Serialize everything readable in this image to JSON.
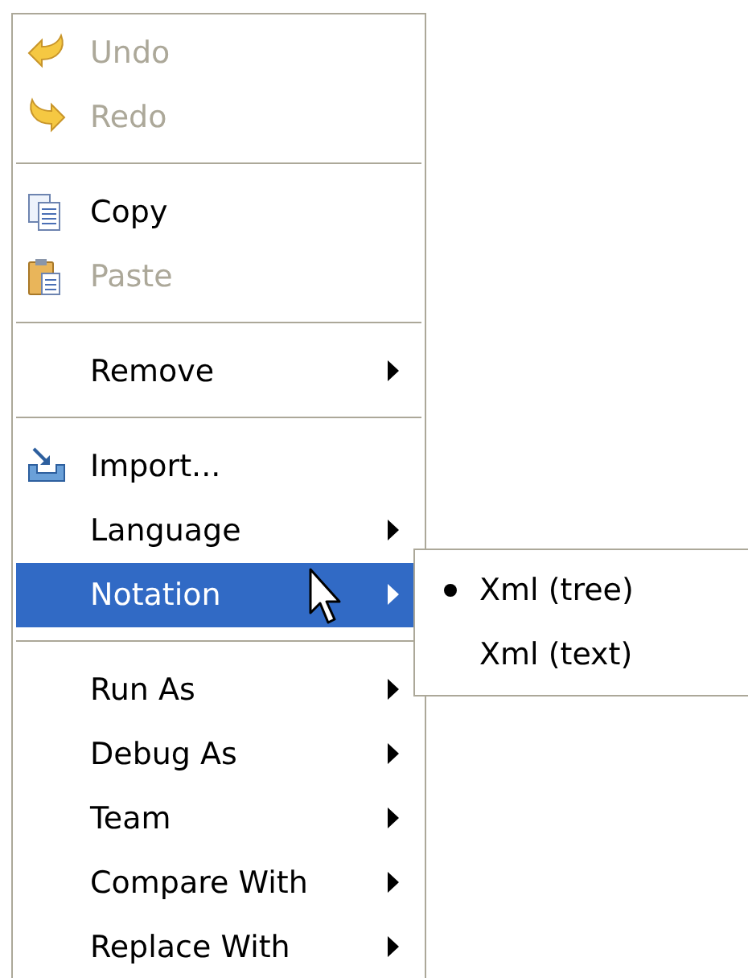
{
  "menu": {
    "items": [
      {
        "kind": "item",
        "label": "Undo",
        "disabled": true,
        "submenu": false,
        "selected": false
      },
      {
        "kind": "item",
        "label": "Redo",
        "disabled": true,
        "submenu": false,
        "selected": false
      },
      {
        "kind": "separator"
      },
      {
        "kind": "item",
        "label": "Copy",
        "disabled": false,
        "submenu": false,
        "selected": false
      },
      {
        "kind": "item",
        "label": "Paste",
        "disabled": true,
        "submenu": false,
        "selected": false
      },
      {
        "kind": "separator"
      },
      {
        "kind": "item",
        "label": "Remove",
        "disabled": false,
        "submenu": true,
        "selected": false
      },
      {
        "kind": "separator"
      },
      {
        "kind": "item",
        "label": "Import...",
        "disabled": false,
        "submenu": false,
        "selected": false
      },
      {
        "kind": "item",
        "label": "Language",
        "disabled": false,
        "submenu": true,
        "selected": false
      },
      {
        "kind": "item",
        "label": "Notation",
        "disabled": false,
        "submenu": true,
        "selected": true
      },
      {
        "kind": "separator"
      },
      {
        "kind": "item",
        "label": "Run As",
        "disabled": false,
        "submenu": true,
        "selected": false
      },
      {
        "kind": "item",
        "label": "Debug As",
        "disabled": false,
        "submenu": true,
        "selected": false
      },
      {
        "kind": "item",
        "label": "Team",
        "disabled": false,
        "submenu": true,
        "selected": false
      },
      {
        "kind": "item",
        "label": "Compare With",
        "disabled": false,
        "submenu": true,
        "selected": false
      },
      {
        "kind": "item",
        "label": "Replace With",
        "disabled": false,
        "submenu": true,
        "selected": false
      }
    ]
  },
  "submenu": {
    "items": [
      {
        "label": "Xml (tree)",
        "checked": true
      },
      {
        "label": "Xml (text)",
        "checked": false
      }
    ]
  }
}
